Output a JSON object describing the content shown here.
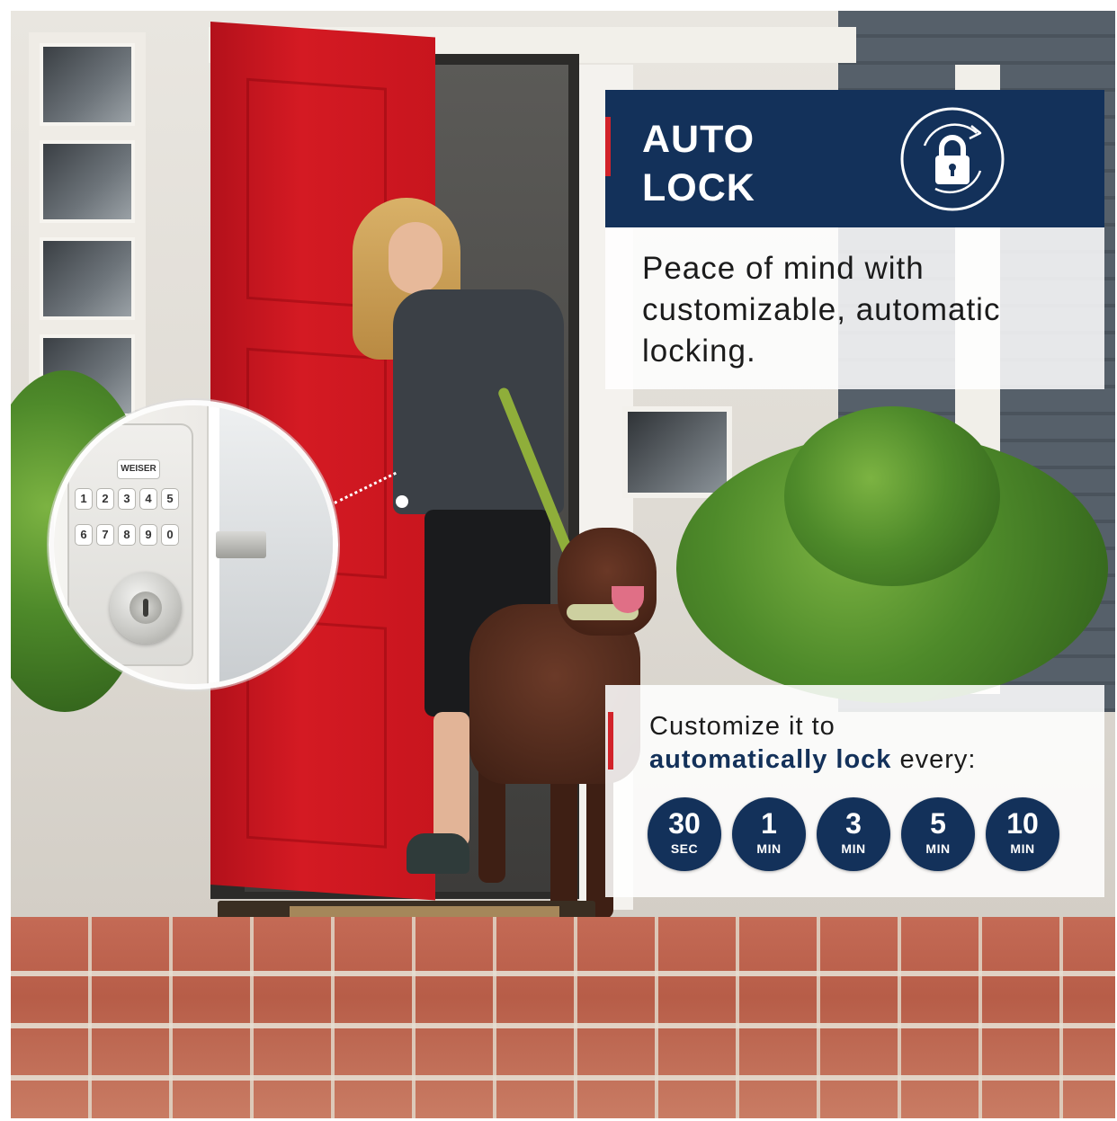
{
  "headline": {
    "line1": "AUTO",
    "line2": "LOCK",
    "icon": "auto-lock-padlock-icon"
  },
  "description": "Peace of mind with customizable, automatic locking.",
  "customize": {
    "line1": "Customize it to",
    "line2_emphasis": "automatically lock",
    "line2_rest": " every:"
  },
  "intervals": [
    {
      "value": "30",
      "unit": "SEC"
    },
    {
      "value": "1",
      "unit": "MIN"
    },
    {
      "value": "3",
      "unit": "MIN"
    },
    {
      "value": "5",
      "unit": "MIN"
    },
    {
      "value": "10",
      "unit": "MIN"
    }
  ],
  "inset": {
    "brand": "WEISER",
    "keys_row1": [
      "1",
      "2",
      "3",
      "4",
      "5"
    ],
    "keys_row2": [
      "6",
      "7",
      "8",
      "9",
      "0"
    ]
  },
  "colors": {
    "navy": "#13315a",
    "accent_red": "#d2232a",
    "door_red": "#c8151e"
  }
}
